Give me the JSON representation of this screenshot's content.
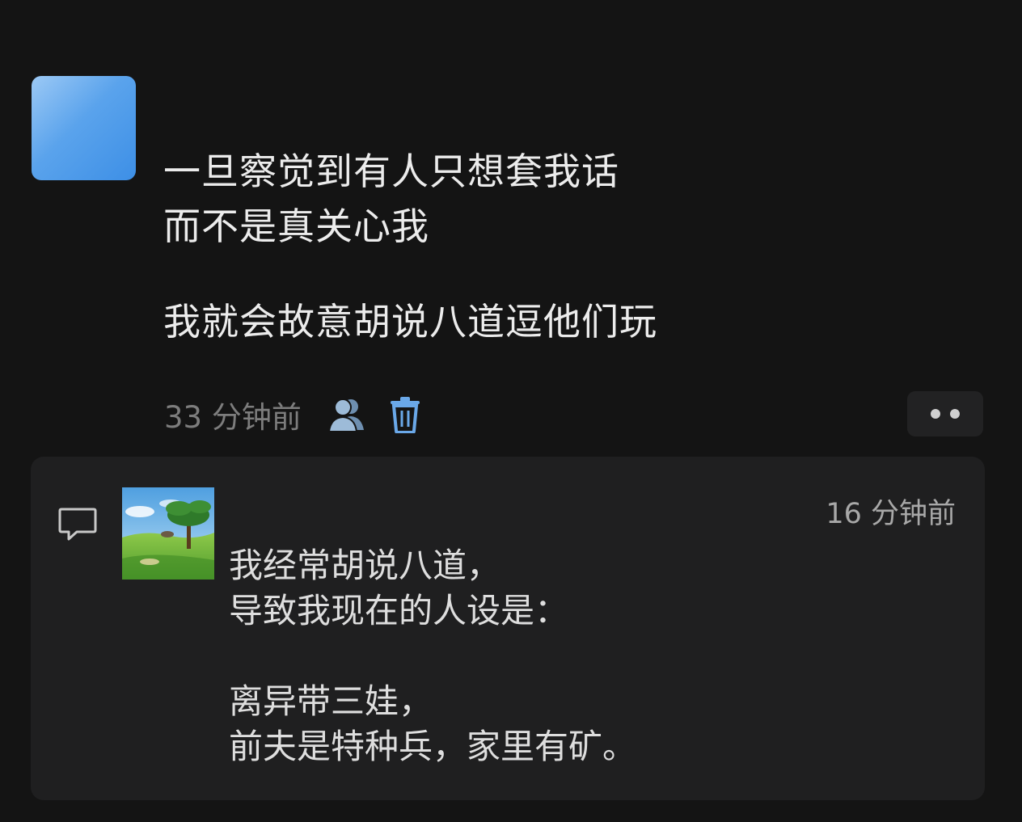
{
  "post": {
    "lines": [
      "一旦察觉到有人只想套我话",
      "而不是真关心我",
      "我就会故意胡说八道逗他们玩"
    ],
    "time": "33 分钟前",
    "icons": {
      "visibility": "user-icon",
      "delete": "trash-icon",
      "more": "more-dots-icon"
    }
  },
  "reply": {
    "time": "16 分钟前",
    "lines": [
      "我经常胡说八道，",
      "导致我现在的人设是：",
      "离异带三娃，",
      "前夫是特种兵，家里有矿。"
    ],
    "icons": {
      "comment": "comment-icon"
    }
  },
  "colors": {
    "background": "#141414",
    "card": "#1f1f20",
    "avatar_blue": "#4a98e9"
  }
}
